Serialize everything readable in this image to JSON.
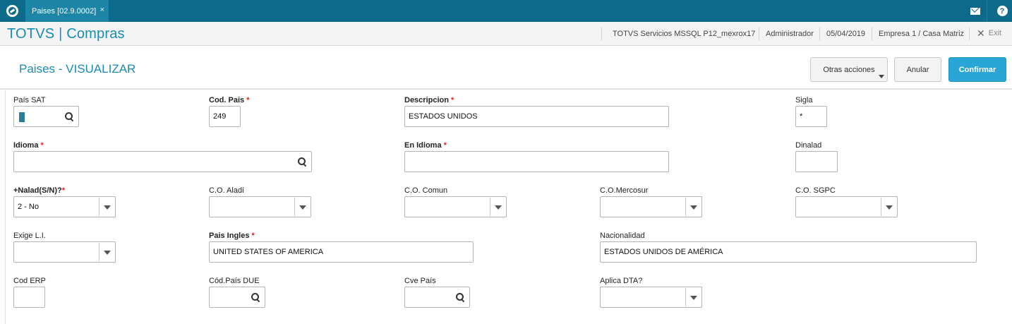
{
  "tab": {
    "label": "Paises [02.9.0002]",
    "close": "×"
  },
  "header": {
    "app_title": "TOTVS | Compras",
    "environment": "TOTVS Servicios MSSQL P12_mexrox17",
    "user": "Administrador",
    "date": "05/04/2019",
    "company": "Empresa 1 / Casa Matriz",
    "exit_label": "Exit"
  },
  "form": {
    "title": "Paises - VISUALIZAR",
    "buttons": {
      "more_actions": "Otras acciones",
      "cancel": "Anular",
      "confirm": "Confirmar"
    }
  },
  "fields": {
    "pais_sat": {
      "label": "País SAT",
      "value": ""
    },
    "cod_pais": {
      "label": "Cod. Pais",
      "value": "249"
    },
    "descripcion": {
      "label": "Descripcion",
      "value": "ESTADOS UNIDOS"
    },
    "sigla": {
      "label": "Sigla",
      "value": "*"
    },
    "idioma": {
      "label": "Idioma",
      "value": ""
    },
    "en_idioma": {
      "label": "En Idioma",
      "value": ""
    },
    "dinalad": {
      "label": "Dinalad",
      "value": ""
    },
    "nalad": {
      "label": "+Nalad(S/N)?",
      "value": "2 - No"
    },
    "co_aladi": {
      "label": "C.O. Aladi",
      "value": ""
    },
    "co_comun": {
      "label": "C.O. Comun",
      "value": ""
    },
    "co_mercosur": {
      "label": "C.O.Mercosur",
      "value": ""
    },
    "co_sgpc": {
      "label": "C.O. SGPC",
      "value": ""
    },
    "exige_li": {
      "label": "Exige L.I.",
      "value": ""
    },
    "pais_ingles": {
      "label": "Pais Ingles",
      "value": "UNITED STATES OF AMERICA"
    },
    "nacionalidad": {
      "label": "Nacionalidad",
      "value": "ESTADOS UNIDOS DE AMÉRICA"
    },
    "cod_erp": {
      "label": "Cod ERP",
      "value": ""
    },
    "cod_pais_due": {
      "label": "Cód.País DUE",
      "value": ""
    },
    "cve_pais": {
      "label": "Cve País",
      "value": ""
    },
    "aplica_dta": {
      "label": "Aplica DTA?",
      "value": ""
    }
  },
  "required_marker": "*",
  "colors": {
    "topbar": "#0e6a8a",
    "accent": "#1a8bb4",
    "confirm": "#29a6d6",
    "required": "#e02020"
  },
  "icons": {
    "logo": "totvs-logo-icon",
    "mail": "mail-icon",
    "help": "help-icon",
    "exit": "close-icon",
    "lookup": "search-icon",
    "dropdown": "chevron-down-icon"
  }
}
